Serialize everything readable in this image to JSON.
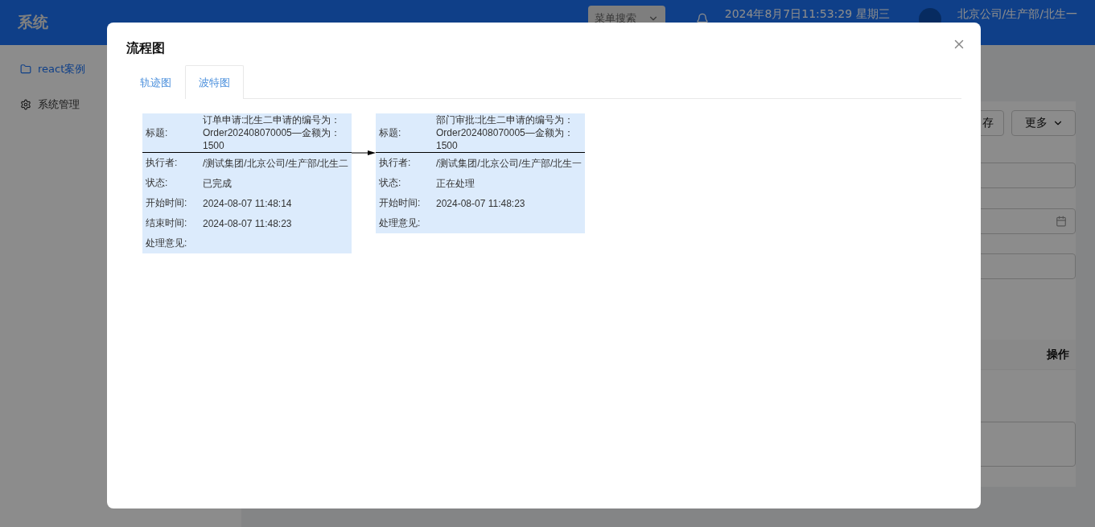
{
  "header": {
    "title": "系统",
    "menu_search": "菜单搜索",
    "datetime": "2024年8月7日11:53:29 星期三",
    "user": "北京公司/生产部/北生一"
  },
  "sidebar": {
    "items": [
      {
        "label": "react案例",
        "selected": true
      },
      {
        "label": "系统管理",
        "selected": false
      }
    ]
  },
  "background": {
    "buttons": [
      "存",
      "更多"
    ],
    "table_header": "操作"
  },
  "dialog": {
    "title": "流程图",
    "tabs": [
      {
        "label": "轨迹图",
        "selected": false
      },
      {
        "label": "波特图",
        "selected": true
      }
    ],
    "nodes": [
      {
        "fields": [
          {
            "label": "标题:",
            "value": "订单申请:北生二申请的编号为：Order202408070005—金额为：1500"
          },
          {
            "label": "执行者:",
            "value": "/测试集团/北京公司/生产部/北生二"
          },
          {
            "label": "状态:",
            "value": "已完成"
          },
          {
            "label": "开始时间:",
            "value": "2024-08-07 11:48:14"
          },
          {
            "label": "结束时间:",
            "value": "2024-08-07 11:48:23"
          },
          {
            "label": "处理意见:"
          }
        ]
      },
      {
        "fields": [
          {
            "label": "标题:",
            "value": "部门审批:北生二申请的编号为：Order202408070005—金额为：1500"
          },
          {
            "label": "执行者:",
            "value": "/测试集团/北京公司/生产部/北生一"
          },
          {
            "label": "状态:",
            "value": "正在处理"
          },
          {
            "label": "开始时间:",
            "value": "2024-08-07 11:48:23"
          },
          {
            "label": "处理意见:"
          }
        ]
      }
    ]
  }
}
